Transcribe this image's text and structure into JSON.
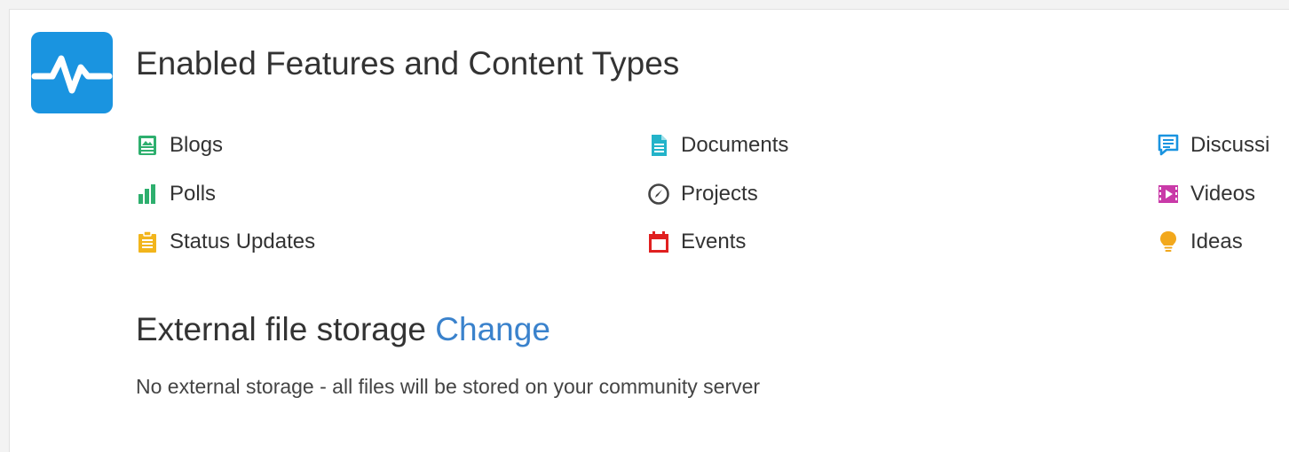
{
  "section": {
    "title": "Enabled Features and Content Types",
    "icon": "activity-pulse-icon",
    "icon_color": "#1a94e0"
  },
  "features": [
    {
      "label": "Blogs",
      "icon": "blog-icon",
      "color": "#2eaf6e"
    },
    {
      "label": "Documents",
      "icon": "document-icon",
      "color": "#23b3c9"
    },
    {
      "label": "Discussi",
      "icon": "discussion-icon",
      "color": "#1a94e0"
    },
    {
      "label": "Polls",
      "icon": "poll-icon",
      "color": "#2eaf6e"
    },
    {
      "label": "Projects",
      "icon": "project-icon",
      "color": "#444444"
    },
    {
      "label": "Videos",
      "icon": "video-icon",
      "color": "#c93aa8"
    },
    {
      "label": "Status Updates",
      "icon": "status-update-icon",
      "color": "#f2b51c"
    },
    {
      "label": "Events",
      "icon": "event-icon",
      "color": "#e02020"
    },
    {
      "label": "Ideas",
      "icon": "idea-icon",
      "color": "#f2a81c"
    }
  ],
  "storage": {
    "title": "External file storage",
    "change_link": "Change",
    "description": "No external storage - all files will be stored on your community server"
  }
}
